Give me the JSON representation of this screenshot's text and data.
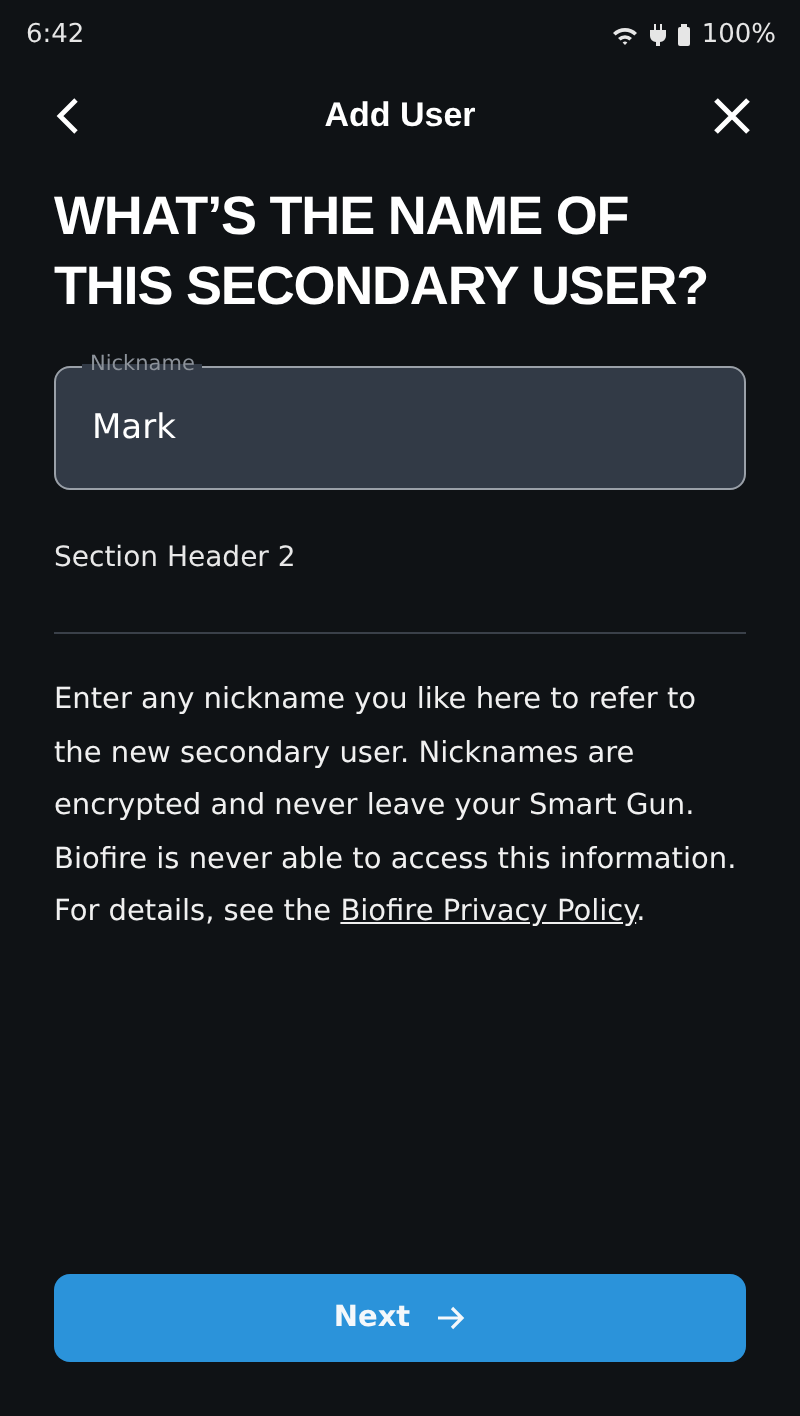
{
  "status_bar": {
    "time": "6:42",
    "battery": "100%"
  },
  "header": {
    "title": "Add User"
  },
  "heading": "WHAT’S THE NAME OF THIS SECONDARY USER?",
  "nickname_field": {
    "label": "Nickname",
    "value": "Mark"
  },
  "section_header": "Section Header 2",
  "body": {
    "text": "Enter any nickname you like here to refer to the new secondary user. Nicknames are encrypted and never leave your Smart Gun. Biofire is never able to access this information. For details, see the ",
    "link": "Biofire Privacy Policy",
    "after": "."
  },
  "next_button": {
    "label": "Next"
  }
}
